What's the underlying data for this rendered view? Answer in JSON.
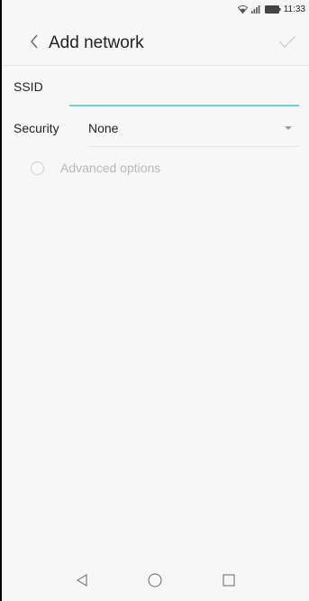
{
  "status_bar": {
    "time": "11:33",
    "icons": [
      "wifi-icon",
      "signal-icon",
      "battery-icon"
    ]
  },
  "header": {
    "title": "Add network",
    "back_icon": "back-chevron-icon",
    "confirm_icon": "checkmark-icon"
  },
  "form": {
    "ssid_label": "SSID",
    "ssid_value": "",
    "security_label": "Security",
    "security_value": "None",
    "advanced_label": "Advanced options",
    "advanced_checked": false
  },
  "nav_bar": {
    "icons": [
      "nav-back-icon",
      "nav-home-icon",
      "nav-recents-icon"
    ]
  },
  "colors": {
    "accent": "#62d4e1",
    "background": "#f7f7f7",
    "disabled_text": "#b8b8b8"
  }
}
